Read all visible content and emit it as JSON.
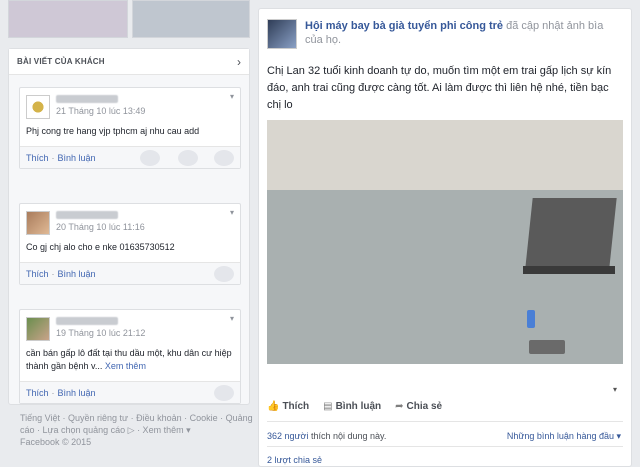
{
  "guest_section": {
    "title": "BÀI VIẾT CỦA KHÁCH",
    "posts": [
      {
        "time": "21 Tháng 10 lúc 13:49",
        "text": "Phj cong tre hang vjp tphcm aj nhu cau add",
        "actions": [
          "Thích",
          "Bình luận"
        ]
      },
      {
        "time": "20 Tháng 10 lúc 11:16",
        "text": "Co gj chj alo cho e nke 01635730512",
        "actions": [
          "Thích",
          "Bình luận"
        ]
      },
      {
        "time": "19 Tháng 10 lúc 21:12",
        "text": "cần bán gấp lô đất tại thu dầu một, khu dân cư hiệp thành gần bệnh v...",
        "more": "Xem thêm",
        "actions": [
          "Thích",
          "Bình luận"
        ]
      }
    ]
  },
  "footer": {
    "line1": "Tiếng Việt · Quyền riêng tư · Điều khoản · Cookie · Quảng",
    "line2": "cáo · Lựa chọn quảng cáo",
    "line2b": " · Xem thêm ▾",
    "line3": "Facebook © 2015"
  },
  "main_post": {
    "page_name": "Hội máy bay bà già tuyển phi công trẻ",
    "action": " đã cập nhật ảnh bìa của họ.",
    "text": "Chị Lan 32 tuổi kinh doanh tự do, muốn tìm một em trai gấp lịch sự kín đáo, anh trai cũng được càng tốt. Ai làm được thì liên hệ nhé, tiền bạc chị lo",
    "actions": [
      "Thích",
      "Bình luận",
      "Chia sẻ"
    ],
    "likes_count": "362 người",
    "likes_suffix": " thích nội dung này.",
    "sort_label": "Những bình luận hàng đầu ▾",
    "shares": "2 lượt chia sẻ"
  }
}
